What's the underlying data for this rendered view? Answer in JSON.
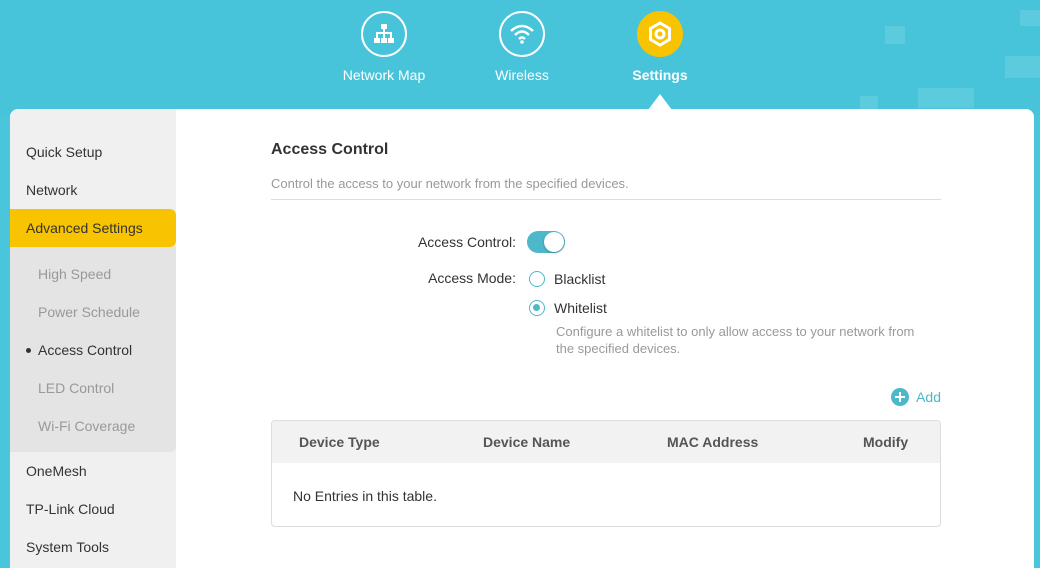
{
  "nav": {
    "items": [
      {
        "label": "Network Map",
        "icon": "network-map-icon"
      },
      {
        "label": "Wireless",
        "icon": "wifi-icon"
      },
      {
        "label": "Settings",
        "icon": "gear-icon"
      }
    ],
    "active": "Settings",
    "accent_color": "#f8c300",
    "header_color": "#47c4da"
  },
  "sidebar": {
    "items": [
      {
        "label": "Quick Setup"
      },
      {
        "label": "Network"
      },
      {
        "label": "Advanced Settings"
      },
      {
        "label": "OneMesh"
      },
      {
        "label": "TP-Link Cloud"
      },
      {
        "label": "System Tools"
      }
    ],
    "active": "Advanced Settings",
    "sub_items": [
      {
        "label": "High Speed"
      },
      {
        "label": "Power Schedule"
      },
      {
        "label": "Access Control"
      },
      {
        "label": "LED Control"
      },
      {
        "label": "Wi-Fi Coverage"
      }
    ],
    "current_sub": "Access Control"
  },
  "main": {
    "title": "Access Control",
    "description": "Control the access to your network from the specified devices.",
    "access_control_label": "Access Control:",
    "access_control_enabled": true,
    "access_mode_label": "Access Mode:",
    "modes": [
      {
        "label": "Blacklist",
        "checked": false
      },
      {
        "label": "Whitelist",
        "checked": true
      }
    ],
    "whitelist_hint": "Configure a whitelist to only allow access to your network from the specified devices.",
    "add_label": "Add",
    "table": {
      "columns": [
        "Device Type",
        "Device Name",
        "MAC Address",
        "Modify"
      ],
      "empty_text": "No Entries in this table."
    },
    "toggle_color": "#4cb8c9"
  }
}
